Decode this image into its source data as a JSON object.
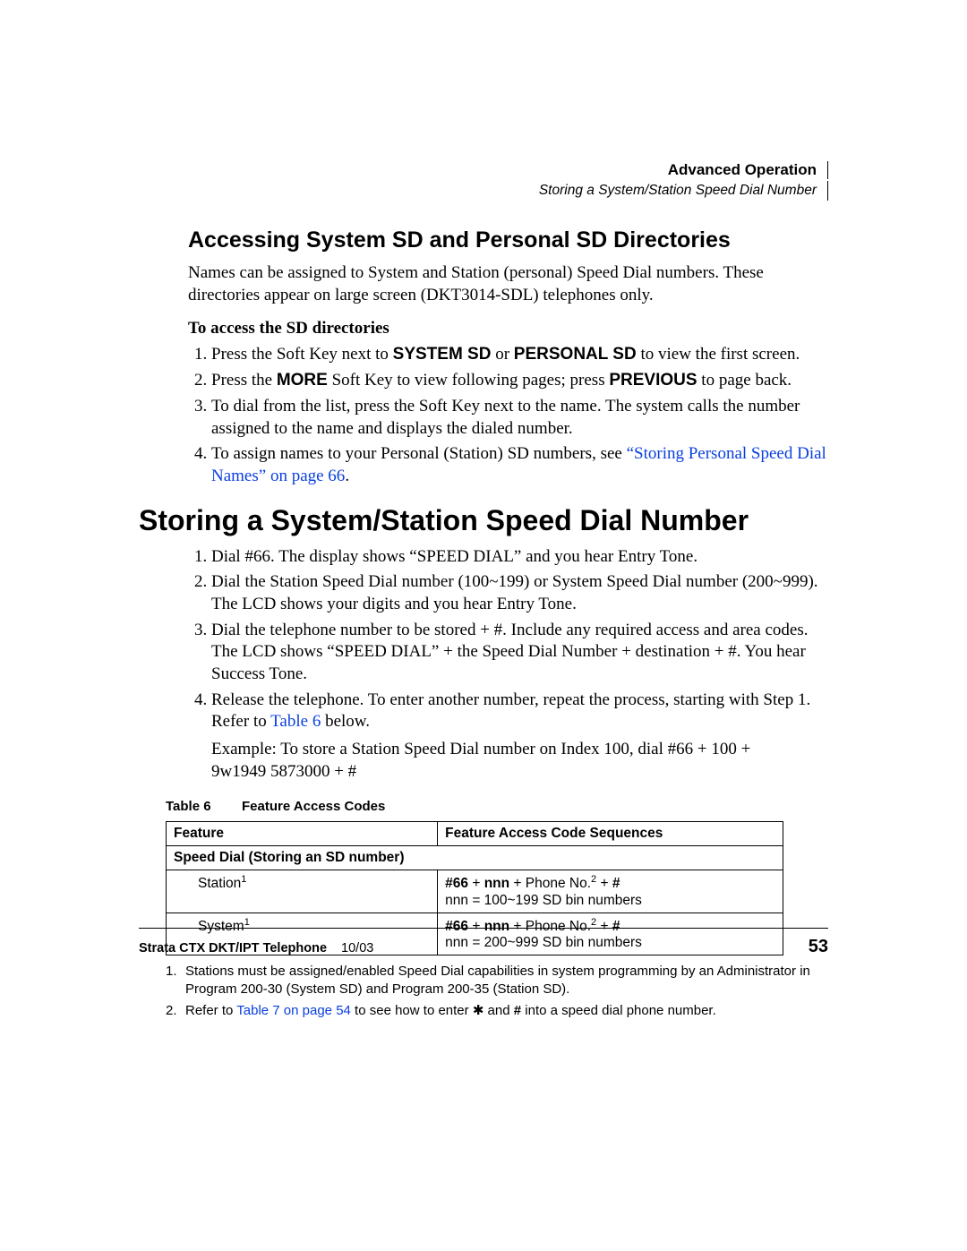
{
  "runningHeader": {
    "title": "Advanced Operation",
    "subtitle": "Storing a System/Station Speed Dial Number"
  },
  "section1": {
    "heading": "Accessing System SD and Personal SD Directories",
    "intro": "Names can be assigned to System and Station (personal) Speed Dial numbers. These directories appear on large screen (DKT3014-SDL) telephones only.",
    "sub": "To access the SD directories",
    "step1_a": "Press the Soft Key next to ",
    "step1_b": "SYSTEM SD",
    "step1_c": " or ",
    "step1_d": "PERSONAL SD",
    "step1_e": " to view the first screen.",
    "step2_a": "Press the ",
    "step2_b": "MORE",
    "step2_c": " Soft Key to view following pages; press ",
    "step2_d": "PREVIOUS",
    "step2_e": " to page back.",
    "step3": "To dial from the list, press the Soft Key next to the name. The system calls the number assigned to the name and displays the dialed number.",
    "step4_a": "To assign names to your Personal (Station) SD numbers, see ",
    "step4_link": "“Storing Personal Speed Dial Names” on page 66",
    "step4_c": "."
  },
  "section2": {
    "heading": "Storing a System/Station Speed Dial Number",
    "step1": "Dial #66. The display shows “SPEED DIAL” and you hear Entry Tone.",
    "step2": "Dial the Station Speed Dial number (100~199) or System Speed Dial number (200~999). The LCD shows your digits and you hear Entry Tone.",
    "step3": "Dial the telephone number to be stored + #. Include any required access and area codes. The LCD shows “SPEED DIAL” + the Speed Dial Number + destination + #. You hear Success Tone.",
    "step4_a": "Release the telephone. To enter another number, repeat the process, starting with Step 1. Refer to ",
    "step4_link": "Table 6",
    "step4_b": " below.",
    "example": "Example: To store a Station Speed Dial number on Index 100, dial #66 + 100 + 9w1949 5873000 + #"
  },
  "table": {
    "caption_a": "Table 6",
    "caption_b": "Feature Access Codes",
    "h1": "Feature",
    "h2": "Feature Access Code Sequences",
    "grp": "Speed Dial (Storing an SD number)",
    "r1c1": "Station",
    "r1_sup": "1",
    "r1c2_a": "#66",
    "r1c2_b": " + ",
    "r1c2_c": "nnn",
    "r1c2_d": " + Phone No.",
    "r1c2_sup": "2",
    "r1c2_e": " + ",
    "r1c2_f": "#",
    "r1c2_line2": "nnn = 100~199 SD bin numbers",
    "r2c1": "System",
    "r2_sup": "1",
    "r2c2_line2": "nnn = 200~999 SD bin numbers"
  },
  "footnotes": {
    "n1": "Stations must be assigned/enabled Speed Dial capabilities in system programming by an Administrator in Program 200-30 (System SD) and Program 200-35 (Station SD).",
    "n2_a": "Refer to ",
    "n2_link": "Table 7 on page 54",
    "n2_b": " to see how to enter ",
    "n2_star": "✱",
    "n2_c": " and ",
    "n2_hash": "#",
    "n2_d": " into a speed dial phone number."
  },
  "footer": {
    "left": "Strata CTX DKT/IPT Telephone",
    "date": "10/03",
    "page": "53"
  }
}
